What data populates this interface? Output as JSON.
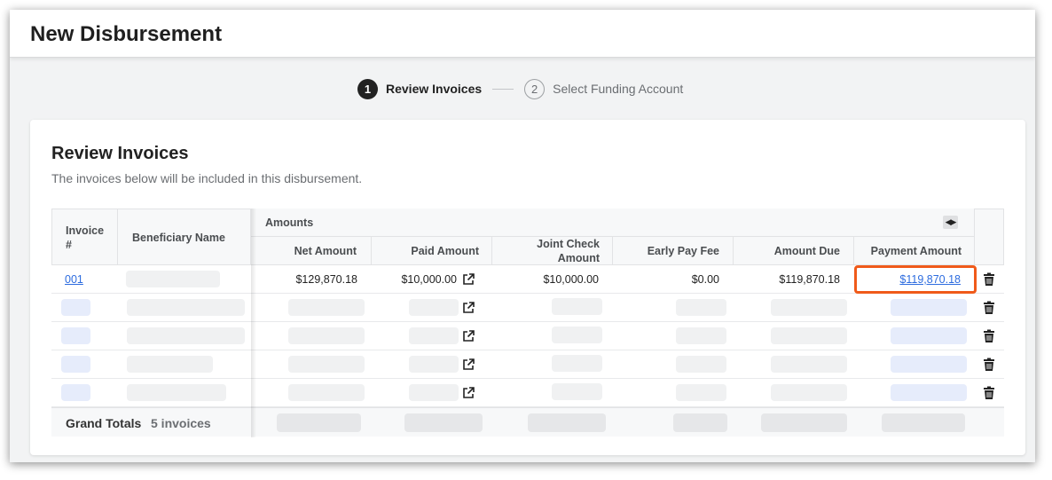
{
  "header": {
    "title": "New Disbursement"
  },
  "stepper": {
    "steps": [
      {
        "number": "1",
        "label": "Review Invoices",
        "state": "active"
      },
      {
        "number": "2",
        "label": "Select Funding Account",
        "state": "inactive"
      }
    ]
  },
  "card": {
    "title": "Review Invoices",
    "subtitle": "The invoices below will be included in this disbursement."
  },
  "table": {
    "group_header": "Amounts",
    "columns": {
      "invoice": "Invoice #",
      "beneficiary": "Beneficiary Name",
      "net_amount": "Net Amount",
      "paid_amount": "Paid Amount",
      "joint_check": "Joint Check Amount",
      "early_pay_fee": "Early Pay Fee",
      "amount_due": "Amount Due",
      "payment_amount": "Payment Amount"
    },
    "rows": [
      {
        "invoice": "001",
        "net_amount": "$129,870.18",
        "paid_amount": "$10,000.00",
        "joint_check": "$10,000.00",
        "early_pay_fee": "$0.00",
        "amount_due": "$119,870.18",
        "payment_amount": "$119,870.18"
      }
    ],
    "placeholder_rows": 4,
    "totals": {
      "label": "Grand Totals",
      "count": "5 invoices"
    }
  },
  "icons": {
    "external_link": "external-link-icon",
    "trash": "trash-icon",
    "scroll_toggle": "scroll-arrows-icon"
  },
  "colors": {
    "link": "#2d6cdf",
    "highlight": "#f05a1a",
    "active_step": "#222222"
  }
}
